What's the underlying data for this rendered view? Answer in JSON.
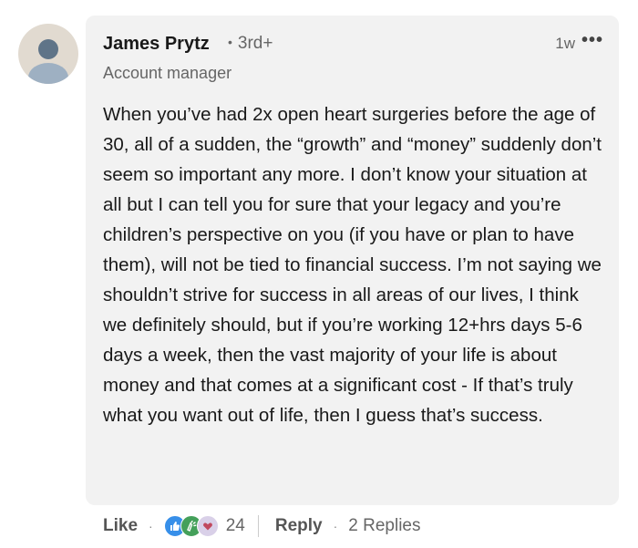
{
  "author": {
    "name": "James Prytz",
    "degree": "3rd+",
    "degree_dot": "•",
    "headline": "Account manager",
    "avatar": "default-person-avatar"
  },
  "meta": {
    "time": "1w",
    "more_label": "•••"
  },
  "comment": {
    "text": "When you’ve had 2x open heart surgeries before the age of 30, all of a sudden, the “growth” and “money” suddenly don’t seem so important any more. I don’t know your situation at all but I can tell you for sure that your legacy and you’re children’s perspective on you (if you have or plan to have them), will not be tied to financial success. I’m not saying we shouldn’t strive for success in all areas of our lives, I think we definitely should, but if you’re working 12+hrs days 5-6 days a week, then the vast majority of your life is about money and that comes at a significant cost - If that’s truly what you want out of life, then I guess that’s success."
  },
  "footer": {
    "like_label": "Like",
    "separator": "·",
    "reactions": [
      "like-icon",
      "celebrate-icon",
      "support-icon"
    ],
    "reaction_count": "24",
    "reply_label": "Reply",
    "replies_label": "2 Replies"
  },
  "colors": {
    "bubble": "#f2f2f2",
    "like": "#378fe9",
    "celebrate": "#44a05a",
    "support": "#d9d0e8"
  }
}
